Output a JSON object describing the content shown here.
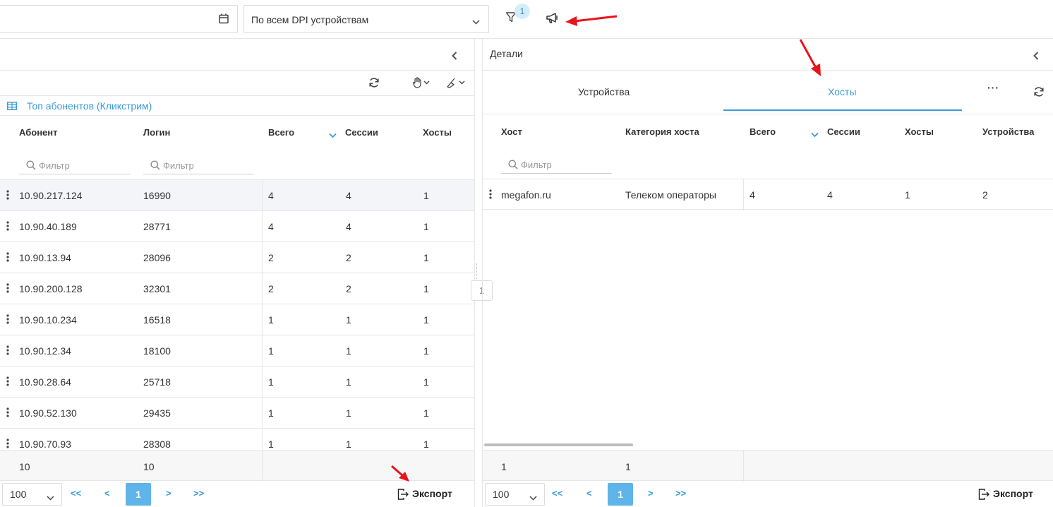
{
  "toolbar": {
    "dpi_select_value": "По всем DPI устройствам",
    "filter_badge": "1"
  },
  "left": {
    "grid_title": "Топ абонентов (Кликстрим)",
    "columns": [
      "Абонент",
      "Логин",
      "Всего",
      "Сессии",
      "Хосты"
    ],
    "filter_placeholder": "Фильтр",
    "rows": [
      [
        "10.90.217.124",
        "16990",
        "4",
        "4",
        "1"
      ],
      [
        "10.90.40.189",
        "28771",
        "4",
        "4",
        "1"
      ],
      [
        "10.90.13.94",
        "28096",
        "2",
        "2",
        "1"
      ],
      [
        "10.90.200.128",
        "32301",
        "2",
        "2",
        "1"
      ],
      [
        "10.90.10.234",
        "16518",
        "1",
        "1",
        "1"
      ],
      [
        "10.90.12.34",
        "18100",
        "1",
        "1",
        "1"
      ],
      [
        "10.90.28.64",
        "25718",
        "1",
        "1",
        "1"
      ],
      [
        "10.90.52.130",
        "29435",
        "1",
        "1",
        "1"
      ],
      [
        "10.90.70.93",
        "28308",
        "1",
        "1",
        "1"
      ]
    ],
    "footer": [
      "10",
      "10"
    ],
    "pager": {
      "page_size": "100",
      "first": "<<",
      "prev": "<",
      "current": "1",
      "next": ">",
      "last": ">>"
    },
    "export_label": "Экспорт"
  },
  "splitter_label": "1",
  "right": {
    "title": "Детали",
    "tabs": [
      "Устройства",
      "Хосты"
    ],
    "more": "···",
    "columns": [
      "Хост",
      "Категория хоста",
      "Всего",
      "Сессии",
      "Хосты",
      "Устройства"
    ],
    "filter_placeholder": "Фильтр",
    "rows": [
      [
        "megafon.ru",
        "Телеком операторы",
        "4",
        "4",
        "1",
        "2"
      ]
    ],
    "footer": [
      "1",
      "1"
    ],
    "pager": {
      "page_size": "100",
      "first": "<<",
      "prev": "<",
      "current": "1",
      "next": ">",
      "last": ">>"
    },
    "export_label": "Экспорт"
  },
  "colors": {
    "accent": "#3a9ad9",
    "annotation_arrow": "#e8141b"
  }
}
